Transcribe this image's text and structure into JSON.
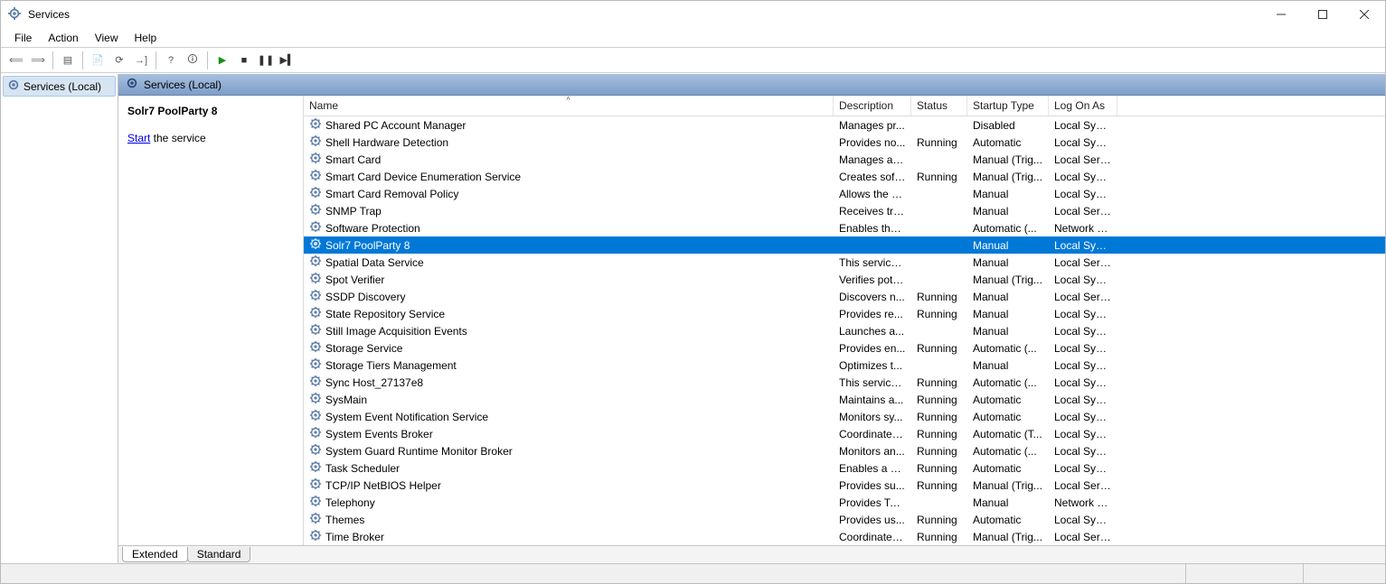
{
  "window": {
    "title": "Services"
  },
  "menu": {
    "items": [
      "File",
      "Action",
      "View",
      "Help"
    ]
  },
  "toolbar": {
    "buttons": [
      {
        "name": "nav-back-icon",
        "glyph": "⟸"
      },
      {
        "name": "nav-forward-icon",
        "glyph": "⟹"
      },
      {
        "sep": true
      },
      {
        "name": "show-hide-tree-icon",
        "glyph": "▤"
      },
      {
        "sep": true
      },
      {
        "name": "properties-icon",
        "glyph": "📄"
      },
      {
        "name": "refresh-icon",
        "glyph": "⟳"
      },
      {
        "name": "export-list-icon",
        "glyph": "→]"
      },
      {
        "sep": true
      },
      {
        "name": "help-icon",
        "glyph": "?"
      },
      {
        "name": "help-topics-icon",
        "glyph": "🛈"
      },
      {
        "sep": true
      },
      {
        "name": "start-service-icon",
        "glyph": "▶",
        "color": "#1a8f1a"
      },
      {
        "name": "stop-service-icon",
        "glyph": "■",
        "color": "#333"
      },
      {
        "name": "pause-service-icon",
        "glyph": "❚❚",
        "color": "#333"
      },
      {
        "name": "restart-service-icon",
        "glyph": "▶▍",
        "color": "#333"
      }
    ]
  },
  "nav": {
    "root_label": "Services (Local)"
  },
  "content_header": {
    "label": "Services (Local)"
  },
  "detail": {
    "selected_name": "Solr7 PoolParty 8",
    "action_link": "Start",
    "action_suffix": " the service"
  },
  "columns": [
    {
      "key": "name",
      "label": "Name",
      "cls": "c-name",
      "sort": "asc"
    },
    {
      "key": "desc",
      "label": "Description",
      "cls": "c-desc"
    },
    {
      "key": "status",
      "label": "Status",
      "cls": "c-stat"
    },
    {
      "key": "startup",
      "label": "Startup Type",
      "cls": "c-start"
    },
    {
      "key": "logon",
      "label": "Log On As",
      "cls": "c-log"
    }
  ],
  "services": [
    {
      "name": "Shared PC Account Manager",
      "desc": "Manages pr...",
      "status": "",
      "startup": "Disabled",
      "logon": "Local Syste..."
    },
    {
      "name": "Shell Hardware Detection",
      "desc": "Provides no...",
      "status": "Running",
      "startup": "Automatic",
      "logon": "Local Syste..."
    },
    {
      "name": "Smart Card",
      "desc": "Manages ac...",
      "status": "",
      "startup": "Manual (Trig...",
      "logon": "Local Service"
    },
    {
      "name": "Smart Card Device Enumeration Service",
      "desc": "Creates soft...",
      "status": "Running",
      "startup": "Manual (Trig...",
      "logon": "Local Syste..."
    },
    {
      "name": "Smart Card Removal Policy",
      "desc": "Allows the s...",
      "status": "",
      "startup": "Manual",
      "logon": "Local Syste..."
    },
    {
      "name": "SNMP Trap",
      "desc": "Receives tra...",
      "status": "",
      "startup": "Manual",
      "logon": "Local Service"
    },
    {
      "name": "Software Protection",
      "desc": "Enables the ...",
      "status": "",
      "startup": "Automatic (...",
      "logon": "Network S..."
    },
    {
      "name": "Solr7 PoolParty 8",
      "desc": "",
      "status": "",
      "startup": "Manual",
      "logon": "Local Syste...",
      "selected": true
    },
    {
      "name": "Spatial Data Service",
      "desc": "This service ...",
      "status": "",
      "startup": "Manual",
      "logon": "Local Service"
    },
    {
      "name": "Spot Verifier",
      "desc": "Verifies pote...",
      "status": "",
      "startup": "Manual (Trig...",
      "logon": "Local Syste..."
    },
    {
      "name": "SSDP Discovery",
      "desc": "Discovers n...",
      "status": "Running",
      "startup": "Manual",
      "logon": "Local Service"
    },
    {
      "name": "State Repository Service",
      "desc": "Provides re...",
      "status": "Running",
      "startup": "Manual",
      "logon": "Local Syste..."
    },
    {
      "name": "Still Image Acquisition Events",
      "desc": "Launches a...",
      "status": "",
      "startup": "Manual",
      "logon": "Local Syste..."
    },
    {
      "name": "Storage Service",
      "desc": "Provides en...",
      "status": "Running",
      "startup": "Automatic (...",
      "logon": "Local Syste..."
    },
    {
      "name": "Storage Tiers Management",
      "desc": "Optimizes t...",
      "status": "",
      "startup": "Manual",
      "logon": "Local Syste..."
    },
    {
      "name": "Sync Host_27137e8",
      "desc": "This service ...",
      "status": "Running",
      "startup": "Automatic (...",
      "logon": "Local Syste..."
    },
    {
      "name": "SysMain",
      "desc": "Maintains a...",
      "status": "Running",
      "startup": "Automatic",
      "logon": "Local Syste..."
    },
    {
      "name": "System Event Notification Service",
      "desc": "Monitors sy...",
      "status": "Running",
      "startup": "Automatic",
      "logon": "Local Syste..."
    },
    {
      "name": "System Events Broker",
      "desc": "Coordinates...",
      "status": "Running",
      "startup": "Automatic (T...",
      "logon": "Local Syste..."
    },
    {
      "name": "System Guard Runtime Monitor Broker",
      "desc": "Monitors an...",
      "status": "Running",
      "startup": "Automatic (...",
      "logon": "Local Syste..."
    },
    {
      "name": "Task Scheduler",
      "desc": "Enables a us...",
      "status": "Running",
      "startup": "Automatic",
      "logon": "Local Syste..."
    },
    {
      "name": "TCP/IP NetBIOS Helper",
      "desc": "Provides su...",
      "status": "Running",
      "startup": "Manual (Trig...",
      "logon": "Local Service"
    },
    {
      "name": "Telephony",
      "desc": "Provides Tel...",
      "status": "",
      "startup": "Manual",
      "logon": "Network S..."
    },
    {
      "name": "Themes",
      "desc": "Provides us...",
      "status": "Running",
      "startup": "Automatic",
      "logon": "Local Syste..."
    },
    {
      "name": "Time Broker",
      "desc": "Coordinates...",
      "status": "Running",
      "startup": "Manual (Trig...",
      "logon": "Local Service"
    }
  ],
  "tabs": {
    "items": [
      "Extended",
      "Standard"
    ],
    "active": 0
  }
}
